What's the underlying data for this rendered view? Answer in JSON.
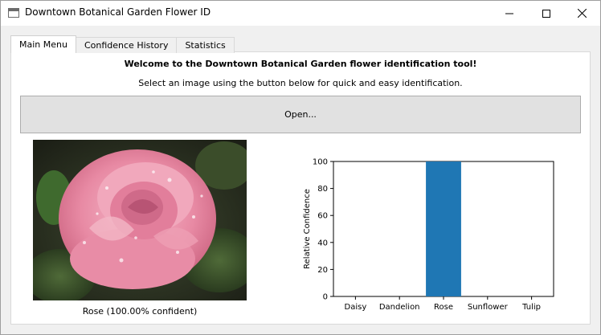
{
  "window": {
    "title": "Downtown Botanical Garden Flower ID"
  },
  "tabs": [
    {
      "label": "Main Menu",
      "active": true
    },
    {
      "label": "Confidence History",
      "active": false
    },
    {
      "label": "Statistics",
      "active": false
    }
  ],
  "main": {
    "welcome": "Welcome to the Downtown Botanical Garden flower identification tool!",
    "instructions": "Select an image using the button below for quick and easy identification.",
    "open_button": "Open...",
    "image_caption": "Rose (100.00% confident)"
  },
  "chart_data": {
    "type": "bar",
    "categories": [
      "Daisy",
      "Dandelion",
      "Rose",
      "Sunflower",
      "Tulip"
    ],
    "values": [
      0,
      0,
      100,
      0,
      0
    ],
    "ylabel": "Relative Confidence",
    "xlabel": "",
    "ylim": [
      0,
      100
    ],
    "yticks": [
      0,
      20,
      40,
      60,
      80,
      100
    ],
    "bar_color": "#1f77b4"
  }
}
